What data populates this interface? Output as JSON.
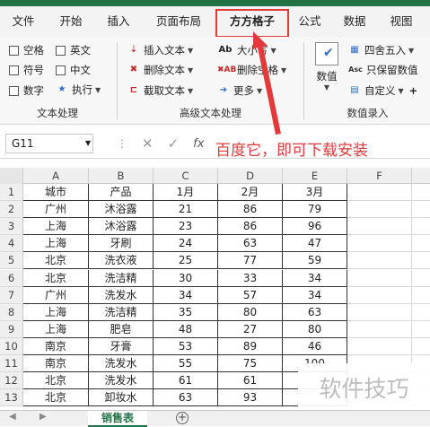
{
  "ribbon_tabs": [
    "文件",
    "开始",
    "插入",
    "页面布局",
    "方方格子",
    "公式",
    "数据",
    "视图"
  ],
  "ribbon": {
    "text_group": {
      "checks": [
        "空格",
        "英文",
        "符号",
        "中文",
        "数字"
      ],
      "exec_label": "执行",
      "group_label": "文本处理"
    },
    "adv_group": {
      "insert": "插入文本",
      "delete": "删除文本",
      "extract": "截取文本",
      "case": "大小写",
      "delete_space": "删除空格",
      "more": "更多",
      "group_label": "高级文本处理"
    },
    "num_group": {
      "value": "数值",
      "round": "四舍五入",
      "keep_value": "只保留数值",
      "custom": "自定义",
      "group_label": "数值录入"
    }
  },
  "formula_bar": {
    "cell_ref": "G11",
    "fx": "fx"
  },
  "annotation": "百度它，即可下载安装",
  "columns": [
    "A",
    "B",
    "C",
    "D",
    "E",
    "F"
  ],
  "header_row": [
    "城市",
    "产品",
    "1月",
    "2月",
    "3月"
  ],
  "rows": [
    [
      "广州",
      "沐浴露",
      "21",
      "86",
      "79"
    ],
    [
      "上海",
      "沐浴露",
      "23",
      "86",
      "96"
    ],
    [
      "上海",
      "牙刷",
      "24",
      "63",
      "47"
    ],
    [
      "北京",
      "洗衣液",
      "25",
      "77",
      "59"
    ],
    [
      "北京",
      "洗洁精",
      "30",
      "33",
      "34"
    ],
    [
      "广州",
      "洗发水",
      "34",
      "57",
      "34"
    ],
    [
      "上海",
      "洗洁精",
      "35",
      "80",
      "63"
    ],
    [
      "上海",
      "肥皂",
      "48",
      "27",
      "80"
    ],
    [
      "南京",
      "牙膏",
      "53",
      "89",
      "46"
    ],
    [
      "南京",
      "洗发水",
      "55",
      "75",
      "100"
    ],
    [
      "北京",
      "洗发水",
      "61",
      "61",
      ""
    ],
    [
      "北京",
      "卸妆水",
      "63",
      "93",
      ""
    ]
  ],
  "row_numbers": [
    "1",
    "2",
    "3",
    "4",
    "5",
    "6",
    "7",
    "8",
    "9",
    "10",
    "11",
    "12",
    "13"
  ],
  "sheet_tab": "销售表",
  "watermark": "软件技巧",
  "colors": {
    "accent": "#217346",
    "annotation": "#e23a3a"
  }
}
